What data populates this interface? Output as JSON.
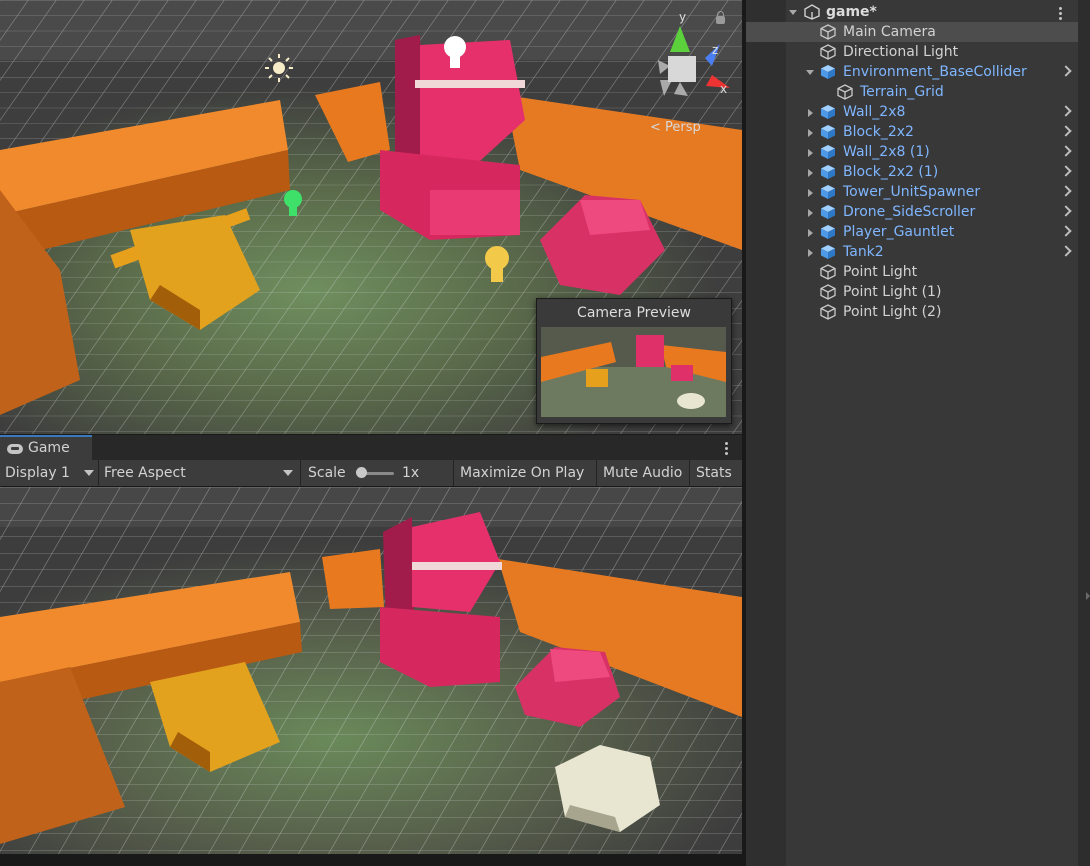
{
  "scene_view": {
    "projection_label": "< Persp",
    "gizmo_axes": {
      "y": "y",
      "z": "z",
      "x": "x"
    },
    "camera_preview_title": "Camera Preview"
  },
  "game_view": {
    "tab_label": "Game",
    "toolbar": {
      "display": "Display 1",
      "aspect": "Free Aspect",
      "scale_label": "Scale",
      "scale_value": "1x",
      "maximize_on_play": "Maximize On Play",
      "mute_audio": "Mute Audio",
      "stats": "Stats"
    }
  },
  "hierarchy": {
    "scene_name": "game*",
    "items": [
      {
        "label": "Main Camera",
        "type": "gameobject"
      },
      {
        "label": "Directional Light",
        "type": "gameobject"
      },
      {
        "label": "Environment_BaseCollider",
        "type": "prefab",
        "expanded": true
      },
      {
        "label": "Terrain_Grid",
        "type": "prefab-child"
      },
      {
        "label": "Wall_2x8",
        "type": "prefab"
      },
      {
        "label": "Block_2x2",
        "type": "prefab"
      },
      {
        "label": "Wall_2x8 (1)",
        "type": "prefab"
      },
      {
        "label": "Block_2x2 (1)",
        "type": "prefab"
      },
      {
        "label": "Tower_UnitSpawner",
        "type": "prefab"
      },
      {
        "label": "Drone_SideScroller",
        "type": "prefab"
      },
      {
        "label": "Player_Gauntlet",
        "type": "prefab"
      },
      {
        "label": "Tank2",
        "type": "prefab"
      },
      {
        "label": "Point Light",
        "type": "gameobject"
      },
      {
        "label": "Point Light (1)",
        "type": "gameobject"
      },
      {
        "label": "Point Light (2)",
        "type": "gameobject"
      }
    ]
  },
  "colors": {
    "prefab_text": "#7fb6ff",
    "wall_orange": "#e8791f",
    "tower_pink": "#e0306a",
    "tank_yellow": "#e7a01b",
    "tab_accent": "#3a79bb"
  },
  "icons": [
    "unity-scene-icon",
    "gameobject-cube-icon",
    "prefab-cube-icon",
    "gamepad-icon",
    "lock-icon",
    "light-bulb-icon",
    "sun-icon",
    "kebab-menu-icon",
    "chevron-right-icon"
  ]
}
